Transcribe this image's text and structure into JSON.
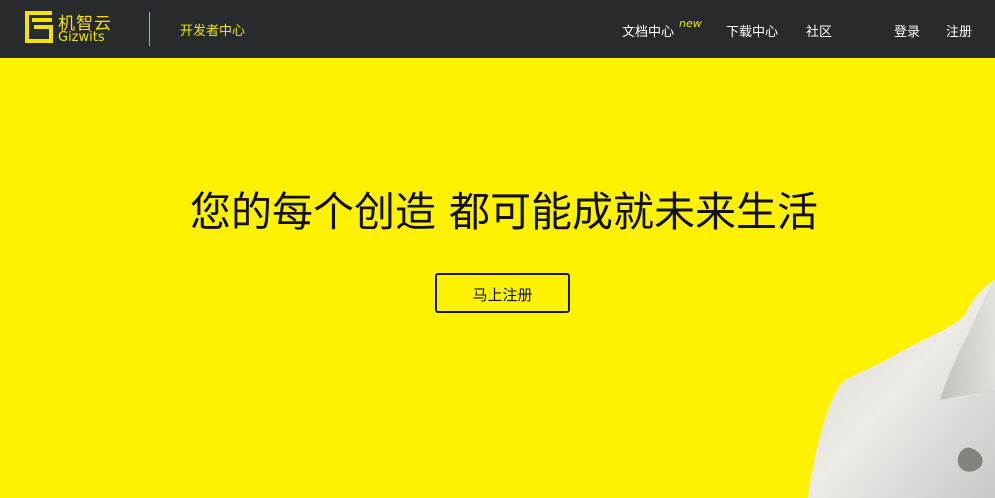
{
  "brand": {
    "name_cn": "机智云",
    "name_en": "Gizwits",
    "section": "开发者中心",
    "accent_color": "#fff200",
    "header_color": "#272b2e"
  },
  "nav": {
    "docs": "文档中心",
    "docs_badge": "new",
    "download": "下载中心",
    "community": "社区",
    "login": "登录",
    "register": "注册"
  },
  "hero": {
    "title": "您的每个创造 都可能成就未来生活",
    "cta": "马上注册"
  }
}
